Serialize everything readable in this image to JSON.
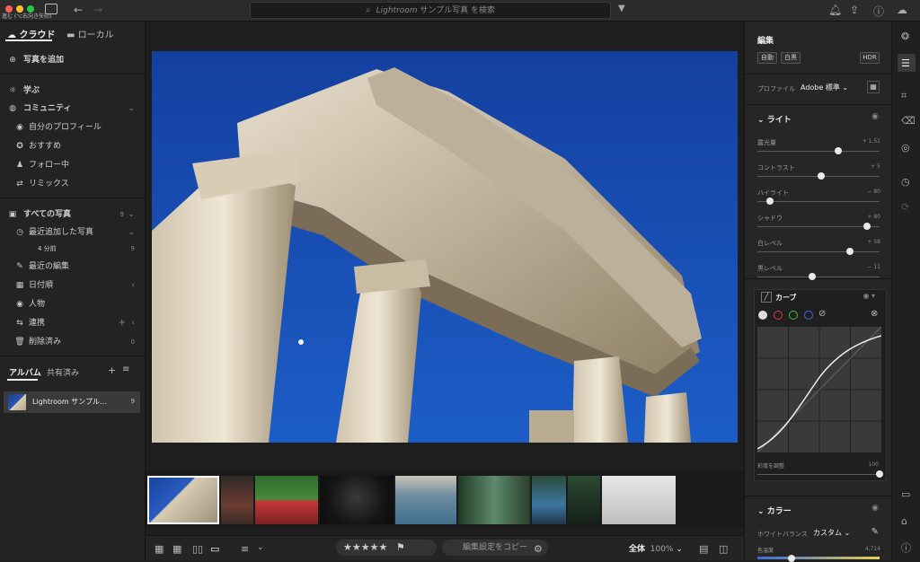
{
  "topbar": {
    "back_label": "進む (⌥右向き矢印)",
    "search_placeholder": "Lightroom サンプル写真 を検索",
    "search_prefix": "Lightroom",
    "search_suffix": " サンプル写真 を検索"
  },
  "left": {
    "tab_cloud": "クラウド",
    "tab_local": "ローカル",
    "add_photos": "写真を追加",
    "learn": "学ぶ",
    "community": "コミュニティ",
    "community_items": [
      "自分のプロフィール",
      "おすすめ",
      "フォロー中",
      "リミックス"
    ],
    "all_photos": "すべての写真",
    "all_photos_count": "9",
    "recent_added": "最近追加した写真",
    "recent_sub": "4 分前",
    "recent_sub_count": "9",
    "recent_edits": "最近の編集",
    "by_date": "日付順",
    "people": "人物",
    "sync": "連携",
    "deleted": "削除済み",
    "deleted_count": "0",
    "albums_tab": "アルバム",
    "shared_tab": "共有済み",
    "album_name": "Lightroom サンプル…",
    "album_count": "9"
  },
  "bottombar": {
    "stars": "★★★★★",
    "copy_edit": "編集設定をコピー",
    "view_all": "全体",
    "zoom": "100%"
  },
  "right": {
    "edit_title": "編集",
    "auto": "自動",
    "bw": "白黒",
    "hdr": "HDR",
    "profile_label": "プロファイル",
    "profile_value": "Adobe 標準",
    "light_title": "ライト",
    "sliders": [
      {
        "label": "露光量",
        "value": "+ 1.51",
        "pos": 0.66
      },
      {
        "label": "コントラスト",
        "value": "+ 5",
        "pos": 0.52
      },
      {
        "label": "ハイライト",
        "value": "− 80",
        "pos": 0.1
      },
      {
        "label": "シャドウ",
        "value": "+ 80",
        "pos": 0.9
      },
      {
        "label": "白レベル",
        "value": "+ 58",
        "pos": 0.76
      },
      {
        "label": "黒レベル",
        "value": "− 11",
        "pos": 0.45
      }
    ],
    "curve_title": "カーブ",
    "curve_sat_label": "彩度を調整",
    "curve_sat_value": "100",
    "color_title": "カラー",
    "wb_label": "ホワイトバランス",
    "wb_value": "カスタム",
    "temp_label": "色温度",
    "temp_value": "4,714"
  },
  "colors": {
    "accent": "#2d6fd6",
    "sky": "#1a48a8"
  }
}
